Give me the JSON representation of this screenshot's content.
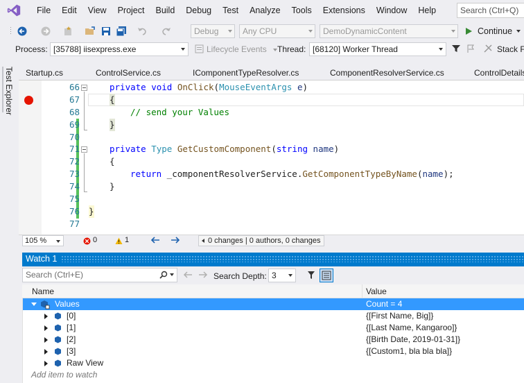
{
  "menu": {
    "items": [
      "File",
      "Edit",
      "View",
      "Project",
      "Build",
      "Debug",
      "Test",
      "Analyze",
      "Tools",
      "Extensions",
      "Window",
      "Help"
    ],
    "search_placeholder": "Search (Ctrl+Q)"
  },
  "toolbar": {
    "configuration": "Debug",
    "platform": "Any CPU",
    "startup_project": "DemoDynamicContent",
    "continue_label": "Continue",
    "stack_frame_label": "Stack Fr"
  },
  "process_bar": {
    "process_label": "Process:",
    "process_value": "[35788] iisexpress.exe",
    "lifecycle_label": "Lifecycle Events",
    "thread_label": "Thread:",
    "thread_value": "[68120] Worker Thread"
  },
  "side_tab": {
    "label": "Test Explorer"
  },
  "doc_tabs": [
    "Startup.cs",
    "ControlService.cs",
    "IComponentTypeResolver.cs",
    "ComponentResolverService.cs",
    "ControlDetails"
  ],
  "editor": {
    "line_numbers": [
      "66",
      "67",
      "68",
      "69",
      "70",
      "71",
      "72",
      "73",
      "74",
      "75",
      "76",
      "77"
    ],
    "lines": {
      "l66": {
        "kw1": "private",
        "kw2": "void",
        "fn": "OnClick",
        "open": "(",
        "ty": "MouseEventArgs",
        "param": " e",
        "close": ")"
      },
      "l67": "{",
      "l68": "// send your Values",
      "l69": "}",
      "l71": {
        "kw1": "private",
        "ty1": "Type",
        "fn": "GetCustomComponent",
        "open": "(",
        "kw2": "string",
        "param": " name",
        "close": ")"
      },
      "l72": "{",
      "l73": {
        "kw": "return",
        "obj": " _componentResolverService.",
        "fn": "GetComponentTypeByName",
        "open": "(",
        "arg": "name",
        "close": ");"
      },
      "l74": "}",
      "l76": "}"
    },
    "zoom": "105 %",
    "errors": "0",
    "warnings": "1",
    "codelens": "0 changes | 0 authors, 0 changes"
  },
  "watch": {
    "title": "Watch 1",
    "search_placeholder": "Search (Ctrl+E)",
    "search_depth_label": "Search Depth:",
    "search_depth_value": "3",
    "col_name": "Name",
    "col_value": "Value",
    "rows": [
      {
        "name": "Values",
        "value": "Count = 4"
      },
      {
        "name": "[0]",
        "value": "{[First Name, Big]}"
      },
      {
        "name": "[1]",
        "value": "{[Last Name, Kangaroo]}"
      },
      {
        "name": "[2]",
        "value": "{[Birth Date, 2019-01-31]}"
      },
      {
        "name": "[3]",
        "value": "{[Custom1, bla bla bla]}"
      },
      {
        "name": "Raw View",
        "value": ""
      }
    ],
    "add_item": "Add item to watch"
  },
  "colors": {
    "accent": "#007acc",
    "selection": "#3399ff",
    "breakpoint": "#e51400",
    "change_bar": "#57c15b",
    "vs_purple": "#865fc5"
  }
}
